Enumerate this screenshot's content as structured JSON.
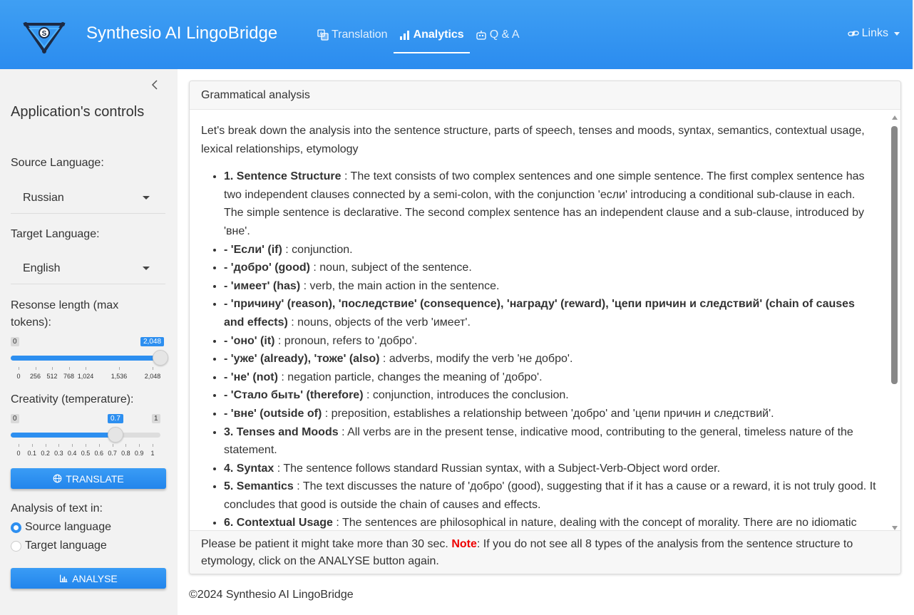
{
  "header": {
    "title": "Synthesio AI LingoBridge",
    "nav": [
      {
        "label": "Translation",
        "icon": "translate-icon"
      },
      {
        "label": "Analytics",
        "icon": "bar-chart-icon"
      },
      {
        "label": "Q & A",
        "icon": "robot-icon"
      }
    ],
    "links_label": "Links"
  },
  "sidebar": {
    "title": "Application's controls",
    "source_label": "Source Language:",
    "source_value": "Russian",
    "target_label": "Target Language:",
    "target_value": "English",
    "length_label": "Resonse length (max tokens):",
    "length_slider": {
      "min": "0",
      "max": "2,048",
      "value": 2048,
      "value_label": "2,048",
      "range": [
        0,
        2048
      ],
      "ticks": [
        "0",
        "256",
        "512",
        "768",
        "1,024",
        "1,536",
        "2,048"
      ],
      "tick_values": [
        0,
        256,
        512,
        768,
        1024,
        1536,
        2048
      ]
    },
    "temp_label": "Creativity (temperature):",
    "temp_slider": {
      "min": "0",
      "max": "1",
      "value": 0.7,
      "value_label": "0.7",
      "range": [
        0,
        1
      ],
      "ticks": [
        "0",
        "0.1",
        "0.2",
        "0.3",
        "0.4",
        "0.5",
        "0.6",
        "0.7",
        "0.8",
        "0.9",
        "1"
      ],
      "tick_values": [
        0,
        0.1,
        0.2,
        0.3,
        0.4,
        0.5,
        0.6,
        0.7,
        0.8,
        0.9,
        1
      ]
    },
    "translate_button": "TRANSLATE",
    "analysis_label": "Analysis of text in:",
    "radio_source": "Source language",
    "radio_target": "Target language",
    "analyse_button": "ANALYSE"
  },
  "card": {
    "title": "Grammatical analysis",
    "intro": "Let's break down the analysis into the sentence structure, parts of speech, tenses and moods, syntax, semantics, contextual usage, lexical relationships, etymology",
    "items": [
      {
        "b": "1. Sentence Structure",
        "t": " : The text consists of two complex sentences and one simple sentence. The first complex sentence has two independent clauses connected by a semi-colon, with the conjunction 'если' introducing a conditional sub-clause in each. The simple sentence is declarative. The second complex sentence has an independent clause and a sub-clause, introduced by 'вне'."
      },
      {
        "b": "- 'Если' (if)",
        "t": " : conjunction."
      },
      {
        "b": "- 'добро' (good)",
        "t": " : noun, subject of the sentence."
      },
      {
        "b": "- 'имеет' (has)",
        "t": " : verb, the main action in the sentence."
      },
      {
        "b": "- 'причину' (reason), 'последствие' (consequence), 'награду' (reward), 'цепи причин и следствий' (chain of causes and effects)",
        "t": " : nouns, objects of the verb 'имеет'."
      },
      {
        "b": "- 'оно' (it)",
        "t": " : pronoun, refers to 'добро'."
      },
      {
        "b": "- 'уже' (already), 'тоже' (also)",
        "t": " : adverbs, modify the verb 'не добро'."
      },
      {
        "b": "- 'не' (not)",
        "t": " : negation particle, changes the meaning of 'добро'."
      },
      {
        "b": "- 'Стало быть' (therefore)",
        "t": " : conjunction, introduces the conclusion."
      },
      {
        "b": "- 'вне' (outside of)",
        "t": " : preposition, establishes a relationship between 'добро' and 'цепи причин и следствий'."
      },
      {
        "b": "3. Tenses and Moods",
        "t": " : All verbs are in the present tense, indicative mood, contributing to the general, timeless nature of the statement."
      },
      {
        "b": "4. Syntax",
        "t": " : The sentence follows standard Russian syntax, with a Subject-Verb-Object word order."
      },
      {
        "b": "5. Semantics",
        "t": " : The text discusses the nature of 'добро' (good), suggesting that if it has a cause or a reward, it is not truly good. It concludes that good is outside the chain of causes and effects."
      },
      {
        "b": "6. Contextual Usage",
        "t": " : The sentences are philosophical in nature, dealing with the concept of morality. There are no idiomatic"
      }
    ],
    "footer_pre": "Please be patient it might take more than 30 sec. ",
    "footer_note": "Note",
    "footer_post": ": If you do not see all 8 types of the analysis from the sentence structure to etymology, click on the ANALYSE button again."
  },
  "copyright": "©2024 Synthesio AI LingoBridge"
}
